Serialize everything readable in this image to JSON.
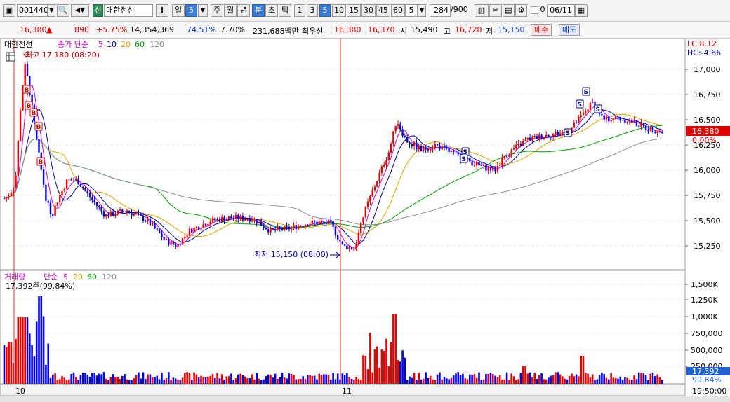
{
  "toolbar": {
    "code": "001440",
    "company": "대한전선",
    "period_badge": "신",
    "excl": "!",
    "il": "일",
    "il_num": "5",
    "ju": "주",
    "wol": "월",
    "nyeon": "년",
    "bun": "분",
    "cho": "초",
    "tik": "틱",
    "intervals": [
      "1",
      "3",
      "5",
      "10",
      "15",
      "30",
      "45",
      "60"
    ],
    "active_interval": "5",
    "count_sel": "5",
    "bars": "284",
    "bars_total": "/900",
    "checkbox_label": "0",
    "date": "06/11"
  },
  "quote": {
    "price": "16,380",
    "arrow": "▲",
    "change": "890",
    "pct": "+5.75%",
    "volume": "14,354,369",
    "vol_ratio": "74.51%",
    "turnover": "7.70%",
    "amount": "231,688백만",
    "best_label": "최우선",
    "ask": "16,380",
    "bid": "16,370",
    "open_label": "시",
    "open": "15,490",
    "high_label": "고",
    "high": "16,720",
    "low_label": "저",
    "low": "15,150",
    "buy_btn": "매수",
    "sell_btn": "매도"
  },
  "price_panel": {
    "title": "대한전선",
    "legend_prefix": "종가 단순",
    "ma_labels": [
      "5",
      "10",
      "20",
      "60",
      "120"
    ],
    "max_annotation": "최고 17,180 (08:20)",
    "min_annotation": "최저 15,150 (08:00)",
    "lc": "LC:8.12",
    "hc": "HC:-4.66",
    "current_tag": "16,380",
    "pct_tag": "0.00%"
  },
  "volume_panel": {
    "legend_prefix": "거래량",
    "legend_ma": "단순",
    "ma_labels": [
      "5",
      "20",
      "60",
      "120"
    ],
    "info": "17,392주(99.84%)",
    "current_tag": "17,392",
    "pct_tag": "99.84%"
  },
  "time_axis": {
    "labels": [
      "10",
      "11"
    ],
    "clock": "19:50:00"
  },
  "colors": {
    "up": "#e00000",
    "down": "#0000e0",
    "ma5": "#d000d0",
    "ma10": "#0000a0",
    "ma20": "#e0a000",
    "ma60": "#00a000",
    "ma120": "#909090"
  },
  "chart_data": {
    "type": "candlestick",
    "price_axis": [
      "17,000",
      "16,750",
      "16,500",
      "16,250",
      "16,000",
      "15,750",
      "15,500",
      "15,250"
    ],
    "volume_axis": [
      "1,500K",
      "1,250K",
      "1,000K",
      "750,000",
      "500,000",
      "250,000"
    ],
    "signals": [
      "B",
      "B",
      "B",
      "B",
      "B",
      "S",
      "S",
      "S",
      "S",
      "S",
      "S"
    ]
  }
}
